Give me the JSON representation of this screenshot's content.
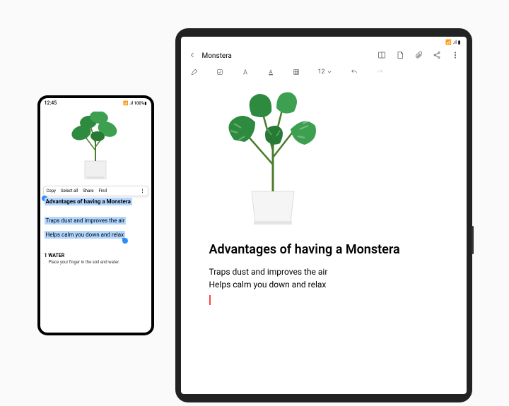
{
  "phone": {
    "status": {
      "time": "12:45",
      "signal": "📶 .ıl 100%▮"
    },
    "contextMenu": {
      "copy": "Copy",
      "selectAll": "Select all",
      "share": "Share",
      "find": "Find",
      "more": "⋮"
    },
    "heading": "Advantages of having a Monstera",
    "line1": "Traps dust and improves the air",
    "line2": "Helps calm you down and relax",
    "water": {
      "title": "1  WATER",
      "text": "Place your finger in the soil and water."
    }
  },
  "tablet": {
    "status": "📶 .ıl ▮",
    "title": "Monstera",
    "fontSize": "12",
    "heading": "Advantages of having a Monstera",
    "line1": "Traps dust and improves the air",
    "line2": "Helps calm you down and relax"
  }
}
